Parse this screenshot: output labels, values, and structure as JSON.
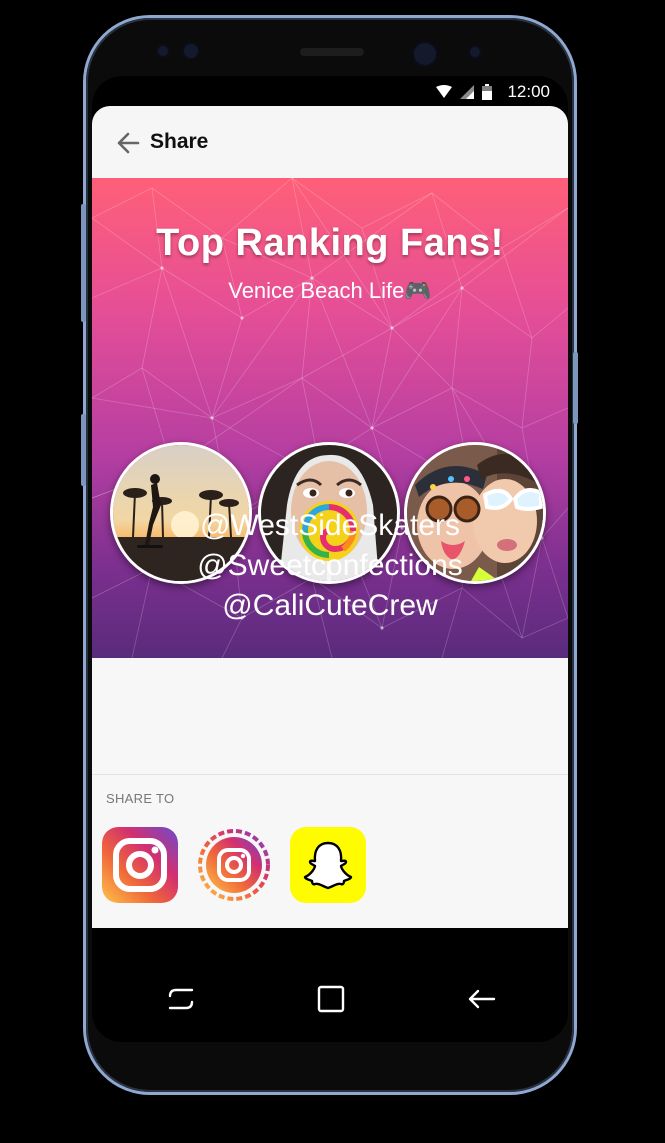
{
  "status_bar": {
    "time": "12:00",
    "icons": [
      "wifi-icon",
      "signal-icon",
      "battery-icon"
    ]
  },
  "app_bar": {
    "back_icon": "arrow-left-icon",
    "title": "Share"
  },
  "banner": {
    "title": "Top Ranking Fans!",
    "subtitle": "Venice Beach Life🎮",
    "avatars": [
      "skateboarder-photo",
      "lollipop-girl-photo",
      "selfie-friends-photo"
    ],
    "handles": [
      "@WestSideSkaters",
      "@Sweetconfections",
      "@CaliCuteCrew"
    ],
    "colors": {
      "top": "#ff5f78",
      "middle": "#b43ea2",
      "bottom": "#5a2b7c"
    }
  },
  "share_sheet": {
    "label": "SHARE TO",
    "apps": [
      {
        "icon": "instagram-icon"
      },
      {
        "icon": "instagram-stories-icon"
      },
      {
        "icon": "snapchat-icon"
      }
    ]
  },
  "nav_bar": {
    "buttons": [
      "recent-apps-icon",
      "home-icon",
      "back-icon"
    ]
  }
}
